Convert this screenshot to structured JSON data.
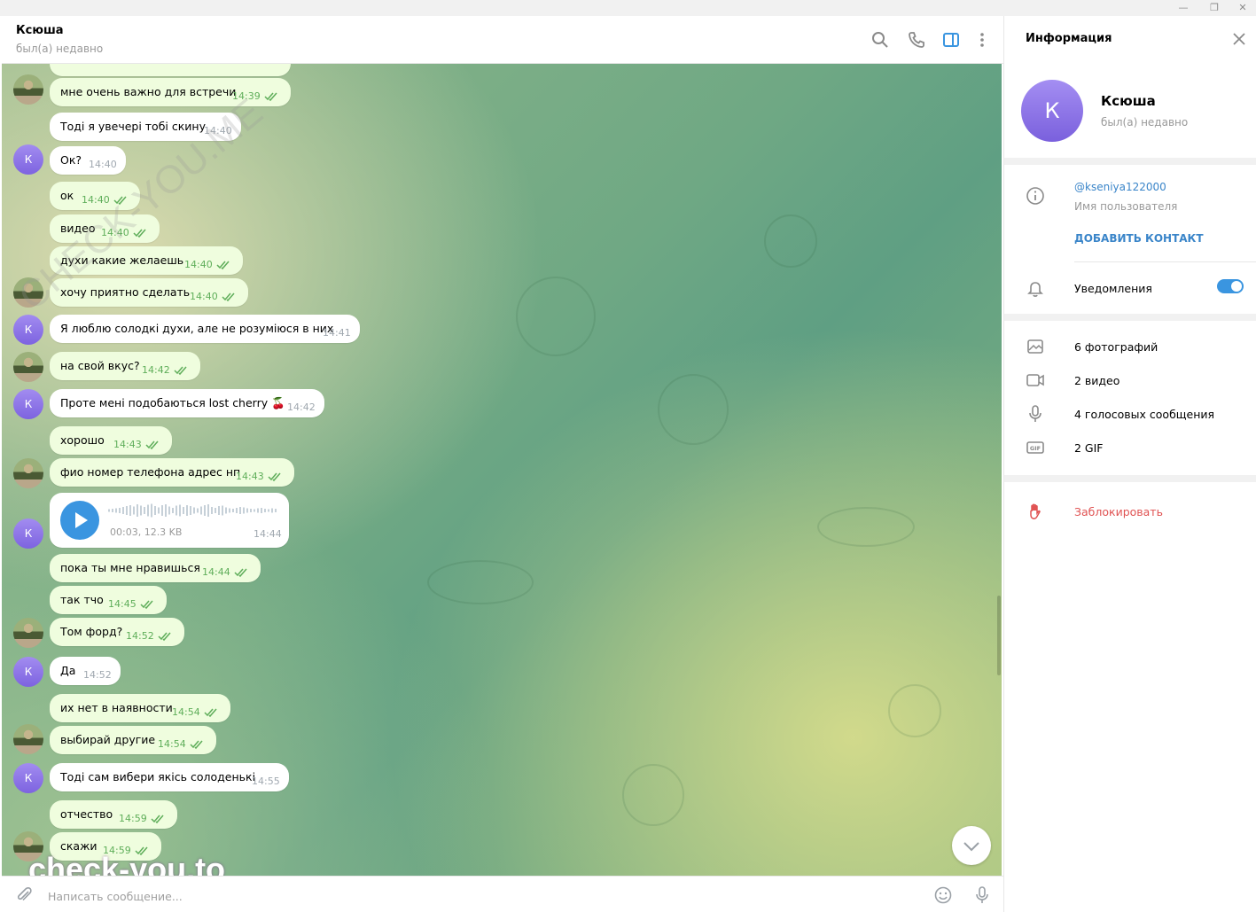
{
  "chat": {
    "name": "Ксюша",
    "status": "был(а) недавно",
    "avatar_letter": "К"
  },
  "messages": [
    {
      "text": "мне очень важно для встречи",
      "time": "14:39",
      "out": true
    },
    {
      "text": "Тоді я увечері тобі скину",
      "time": "14:40",
      "out": false
    },
    {
      "text": "Ок?",
      "time": "14:40",
      "out": false
    },
    {
      "text": "ок",
      "time": "14:40",
      "out": true
    },
    {
      "text": "видео",
      "time": "14:40",
      "out": true
    },
    {
      "text": "духи какие желаешь",
      "time": "14:40",
      "out": true
    },
    {
      "text": "хочу приятно сделать",
      "time": "14:40",
      "out": true
    },
    {
      "text": "Я люблю солодкі духи, але не розуміюся в них",
      "time": "14:41",
      "out": false
    },
    {
      "text": "на свой вкус?",
      "time": "14:42",
      "out": true
    },
    {
      "text": "Проте мені подобаються lost cherry 🍒",
      "time": "14:42",
      "out": false
    },
    {
      "text": "хорошо",
      "time": "14:43",
      "out": true
    },
    {
      "text": "фио номер телефона адрес нп",
      "time": "14:43",
      "out": true
    },
    {
      "text": "пока ты мне нравишься",
      "time": "14:44",
      "out": true
    },
    {
      "text": "так тчо",
      "time": "14:45",
      "out": true
    },
    {
      "text": "Том форд?",
      "time": "14:52",
      "out": true
    },
    {
      "text": "Да",
      "time": "14:52",
      "out": false
    },
    {
      "text": "их нет в наявности",
      "time": "14:54",
      "out": true
    },
    {
      "text": "выбирай другие",
      "time": "14:54",
      "out": true
    },
    {
      "text": "Тоді сам вибери якісь солоденькі",
      "time": "14:55",
      "out": false
    },
    {
      "text": "отчество",
      "time": "14:59",
      "out": true
    },
    {
      "text": "скажи",
      "time": "14:59",
      "out": true
    }
  ],
  "voice": {
    "meta": "00:03, 12.3 KB",
    "time": "14:44"
  },
  "input": {
    "placeholder": "Написать сообщение..."
  },
  "watermarks": {
    "top": "CHECK-YOU.ME",
    "bottom": "check-you.to"
  },
  "info": {
    "title": "Информация",
    "name": "Ксюша",
    "status": "был(а) недавно",
    "avatar_letter": "К",
    "username": "@kseniya122000",
    "username_label": "Имя пользователя",
    "add_contact": "ДОБАВИТЬ КОНТАКТ",
    "notifications": "Уведомления",
    "notifications_on": true,
    "photos": "6 фотографий",
    "videos": "2 видео",
    "voice": "4 голосовых сообщения",
    "gif": "2 GIF",
    "block": "Заблокировать"
  },
  "colors": {
    "accent": "#3a95e0",
    "outgoing_bubble": "#effdde",
    "check": "#5fae5a",
    "block": "#e05353"
  }
}
